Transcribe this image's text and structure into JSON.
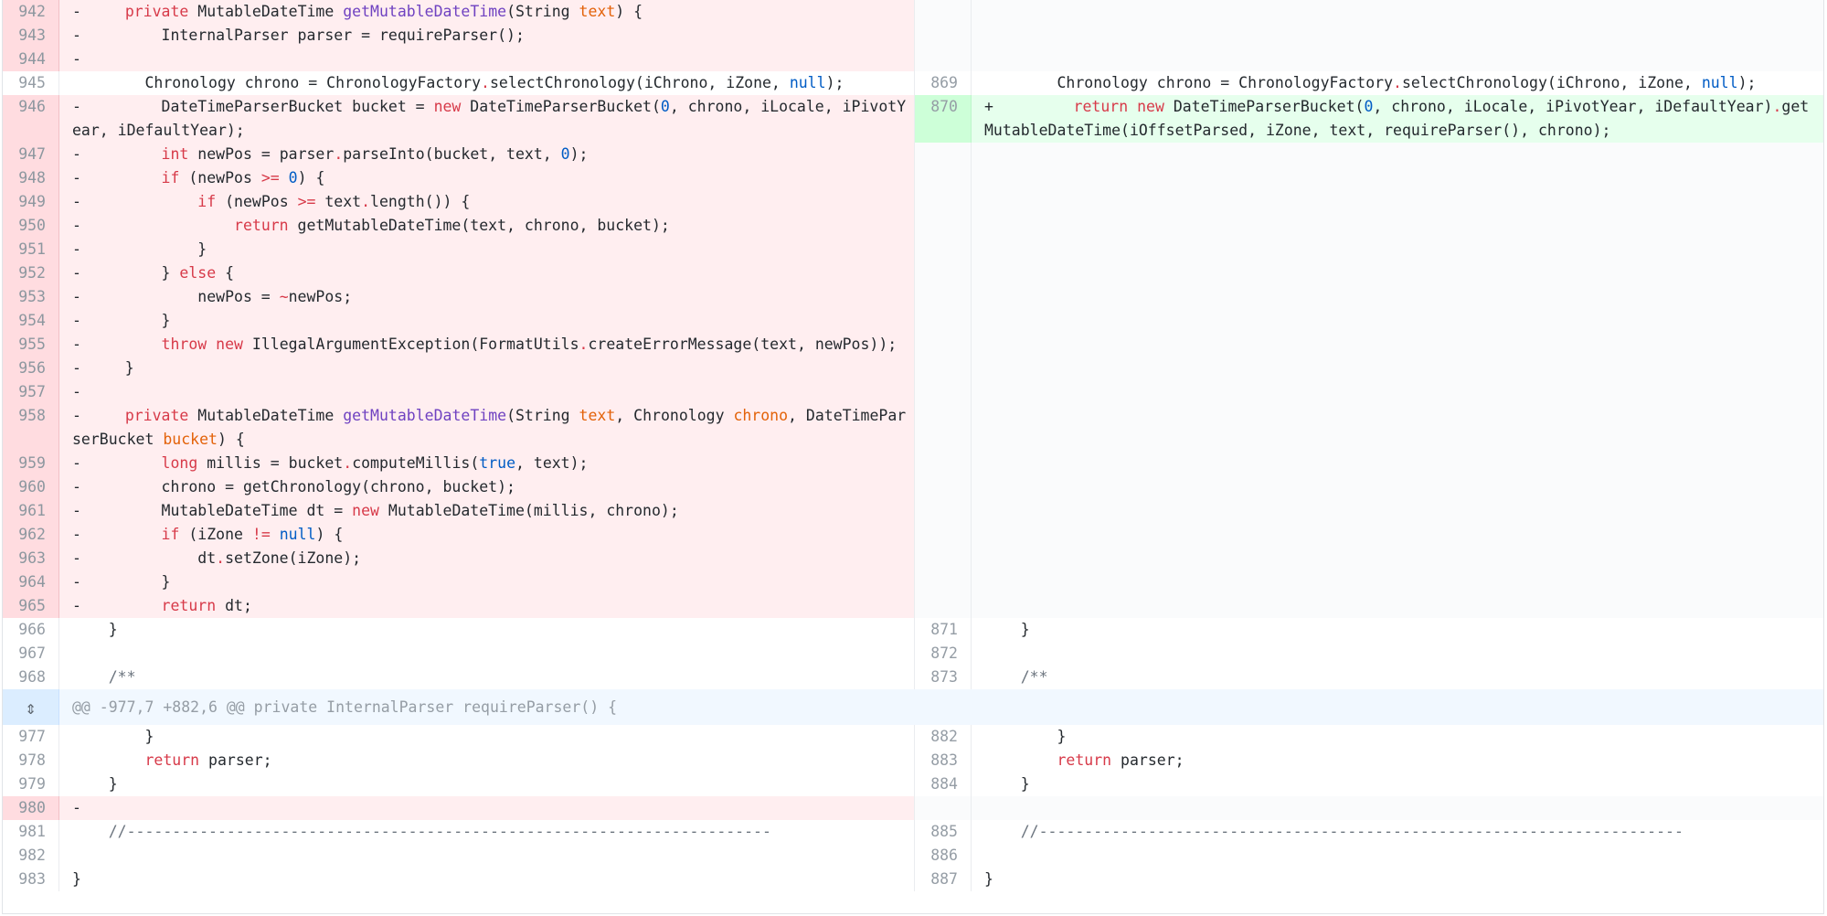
{
  "hunk_header": "@@ -977,7 +882,6 @@ private InternalParser requireParser() {",
  "expand_icon": "expand-vertical-icon",
  "colors": {
    "deleted_line": "#ffeef0",
    "added_line": "#e6ffed",
    "hunk_bg": "#f1f8ff"
  },
  "rows": [
    {
      "type": "del",
      "left": {
        "num": "942",
        "code": "-   private MutableDateTime getMutableDateTime(String text) {"
      }
    },
    {
      "type": "del",
      "left": {
        "num": "943",
        "code": "-       InternalParser parser = requireParser();"
      }
    },
    {
      "type": "del",
      "left": {
        "num": "944",
        "code": "-"
      }
    },
    {
      "type": "ctx",
      "left": {
        "num": "945",
        "code": "        Chronology chrono = ChronologyFactory.selectChronology(iChrono, iZone, null);"
      },
      "right": {
        "num": "869",
        "code": "        Chronology chrono = ChronologyFactory.selectChronology(iChrono, iZone, null);"
      }
    },
    {
      "type": "mod",
      "left": {
        "num": "946",
        "code": "-       DateTimeParserBucket bucket = new DateTimeParserBucket(0, chrono, iLocale, iPivotYear, iDefaultYear);"
      },
      "right": {
        "num": "870",
        "code": "+       return new DateTimeParserBucket(0, chrono, iLocale, iPivotYear, iDefaultYear).getMutableDateTime(iOffsetParsed, iZone, text, requireParser(), chrono);"
      }
    },
    {
      "type": "del",
      "left": {
        "num": "947",
        "code": "-       int newPos = parser.parseInto(bucket, text, 0);"
      }
    },
    {
      "type": "del",
      "left": {
        "num": "948",
        "code": "-       if (newPos >= 0) {"
      }
    },
    {
      "type": "del",
      "left": {
        "num": "949",
        "code": "-           if (newPos >= text.length()) {"
      }
    },
    {
      "type": "del",
      "left": {
        "num": "950",
        "code": "-               return getMutableDateTime(text, chrono, bucket);"
      }
    },
    {
      "type": "del",
      "left": {
        "num": "951",
        "code": "-           }"
      }
    },
    {
      "type": "del",
      "left": {
        "num": "952",
        "code": "-       } else {"
      }
    },
    {
      "type": "del",
      "left": {
        "num": "953",
        "code": "-           newPos = ~newPos;"
      }
    },
    {
      "type": "del",
      "left": {
        "num": "954",
        "code": "-       }"
      }
    },
    {
      "type": "del",
      "left": {
        "num": "955",
        "code": "-       throw new IllegalArgumentException(FormatUtils.createErrorMessage(text, newPos));"
      }
    },
    {
      "type": "del",
      "left": {
        "num": "956",
        "code": "-   }"
      }
    },
    {
      "type": "del",
      "left": {
        "num": "957",
        "code": "-"
      }
    },
    {
      "type": "del",
      "left": {
        "num": "958",
        "code": "-   private MutableDateTime getMutableDateTime(String text, Chronology chrono, DateTimeParserBucket bucket) {"
      }
    },
    {
      "type": "del",
      "left": {
        "num": "959",
        "code": "-       long millis = bucket.computeMillis(true, text);"
      }
    },
    {
      "type": "del",
      "left": {
        "num": "960",
        "code": "-       chrono = getChronology(chrono, bucket);"
      }
    },
    {
      "type": "del",
      "left": {
        "num": "961",
        "code": "-       MutableDateTime dt = new MutableDateTime(millis, chrono);"
      }
    },
    {
      "type": "del",
      "left": {
        "num": "962",
        "code": "-       if (iZone != null) {"
      }
    },
    {
      "type": "del",
      "left": {
        "num": "963",
        "code": "-           dt.setZone(iZone);"
      }
    },
    {
      "type": "del",
      "left": {
        "num": "964",
        "code": "-       }"
      }
    },
    {
      "type": "del",
      "left": {
        "num": "965",
        "code": "-       return dt;"
      }
    },
    {
      "type": "ctx",
      "left": {
        "num": "966",
        "code": "    }"
      },
      "right": {
        "num": "871",
        "code": "    }"
      }
    },
    {
      "type": "ctx",
      "left": {
        "num": "967",
        "code": ""
      },
      "right": {
        "num": "872",
        "code": ""
      }
    },
    {
      "type": "ctx",
      "left": {
        "num": "968",
        "code": "    /**"
      },
      "right": {
        "num": "873",
        "code": "    /**"
      }
    },
    {
      "type": "hunk"
    },
    {
      "type": "ctx",
      "left": {
        "num": "977",
        "code": "        }"
      },
      "right": {
        "num": "882",
        "code": "        }"
      }
    },
    {
      "type": "ctx",
      "left": {
        "num": "978",
        "code": "        return parser;"
      },
      "right": {
        "num": "883",
        "code": "        return parser;"
      }
    },
    {
      "type": "ctx",
      "left": {
        "num": "979",
        "code": "    }"
      },
      "right": {
        "num": "884",
        "code": "    }"
      }
    },
    {
      "type": "del",
      "left": {
        "num": "980",
        "code": "-"
      }
    },
    {
      "type": "ctx",
      "left": {
        "num": "981",
        "code": "    //-----------------------------------------------------------------------"
      },
      "right": {
        "num": "885",
        "code": "    //-----------------------------------------------------------------------"
      }
    },
    {
      "type": "ctx",
      "left": {
        "num": "982",
        "code": ""
      },
      "right": {
        "num": "886",
        "code": ""
      }
    },
    {
      "type": "ctx",
      "left": {
        "num": "983",
        "code": "}"
      },
      "right": {
        "num": "887",
        "code": "}"
      }
    }
  ]
}
